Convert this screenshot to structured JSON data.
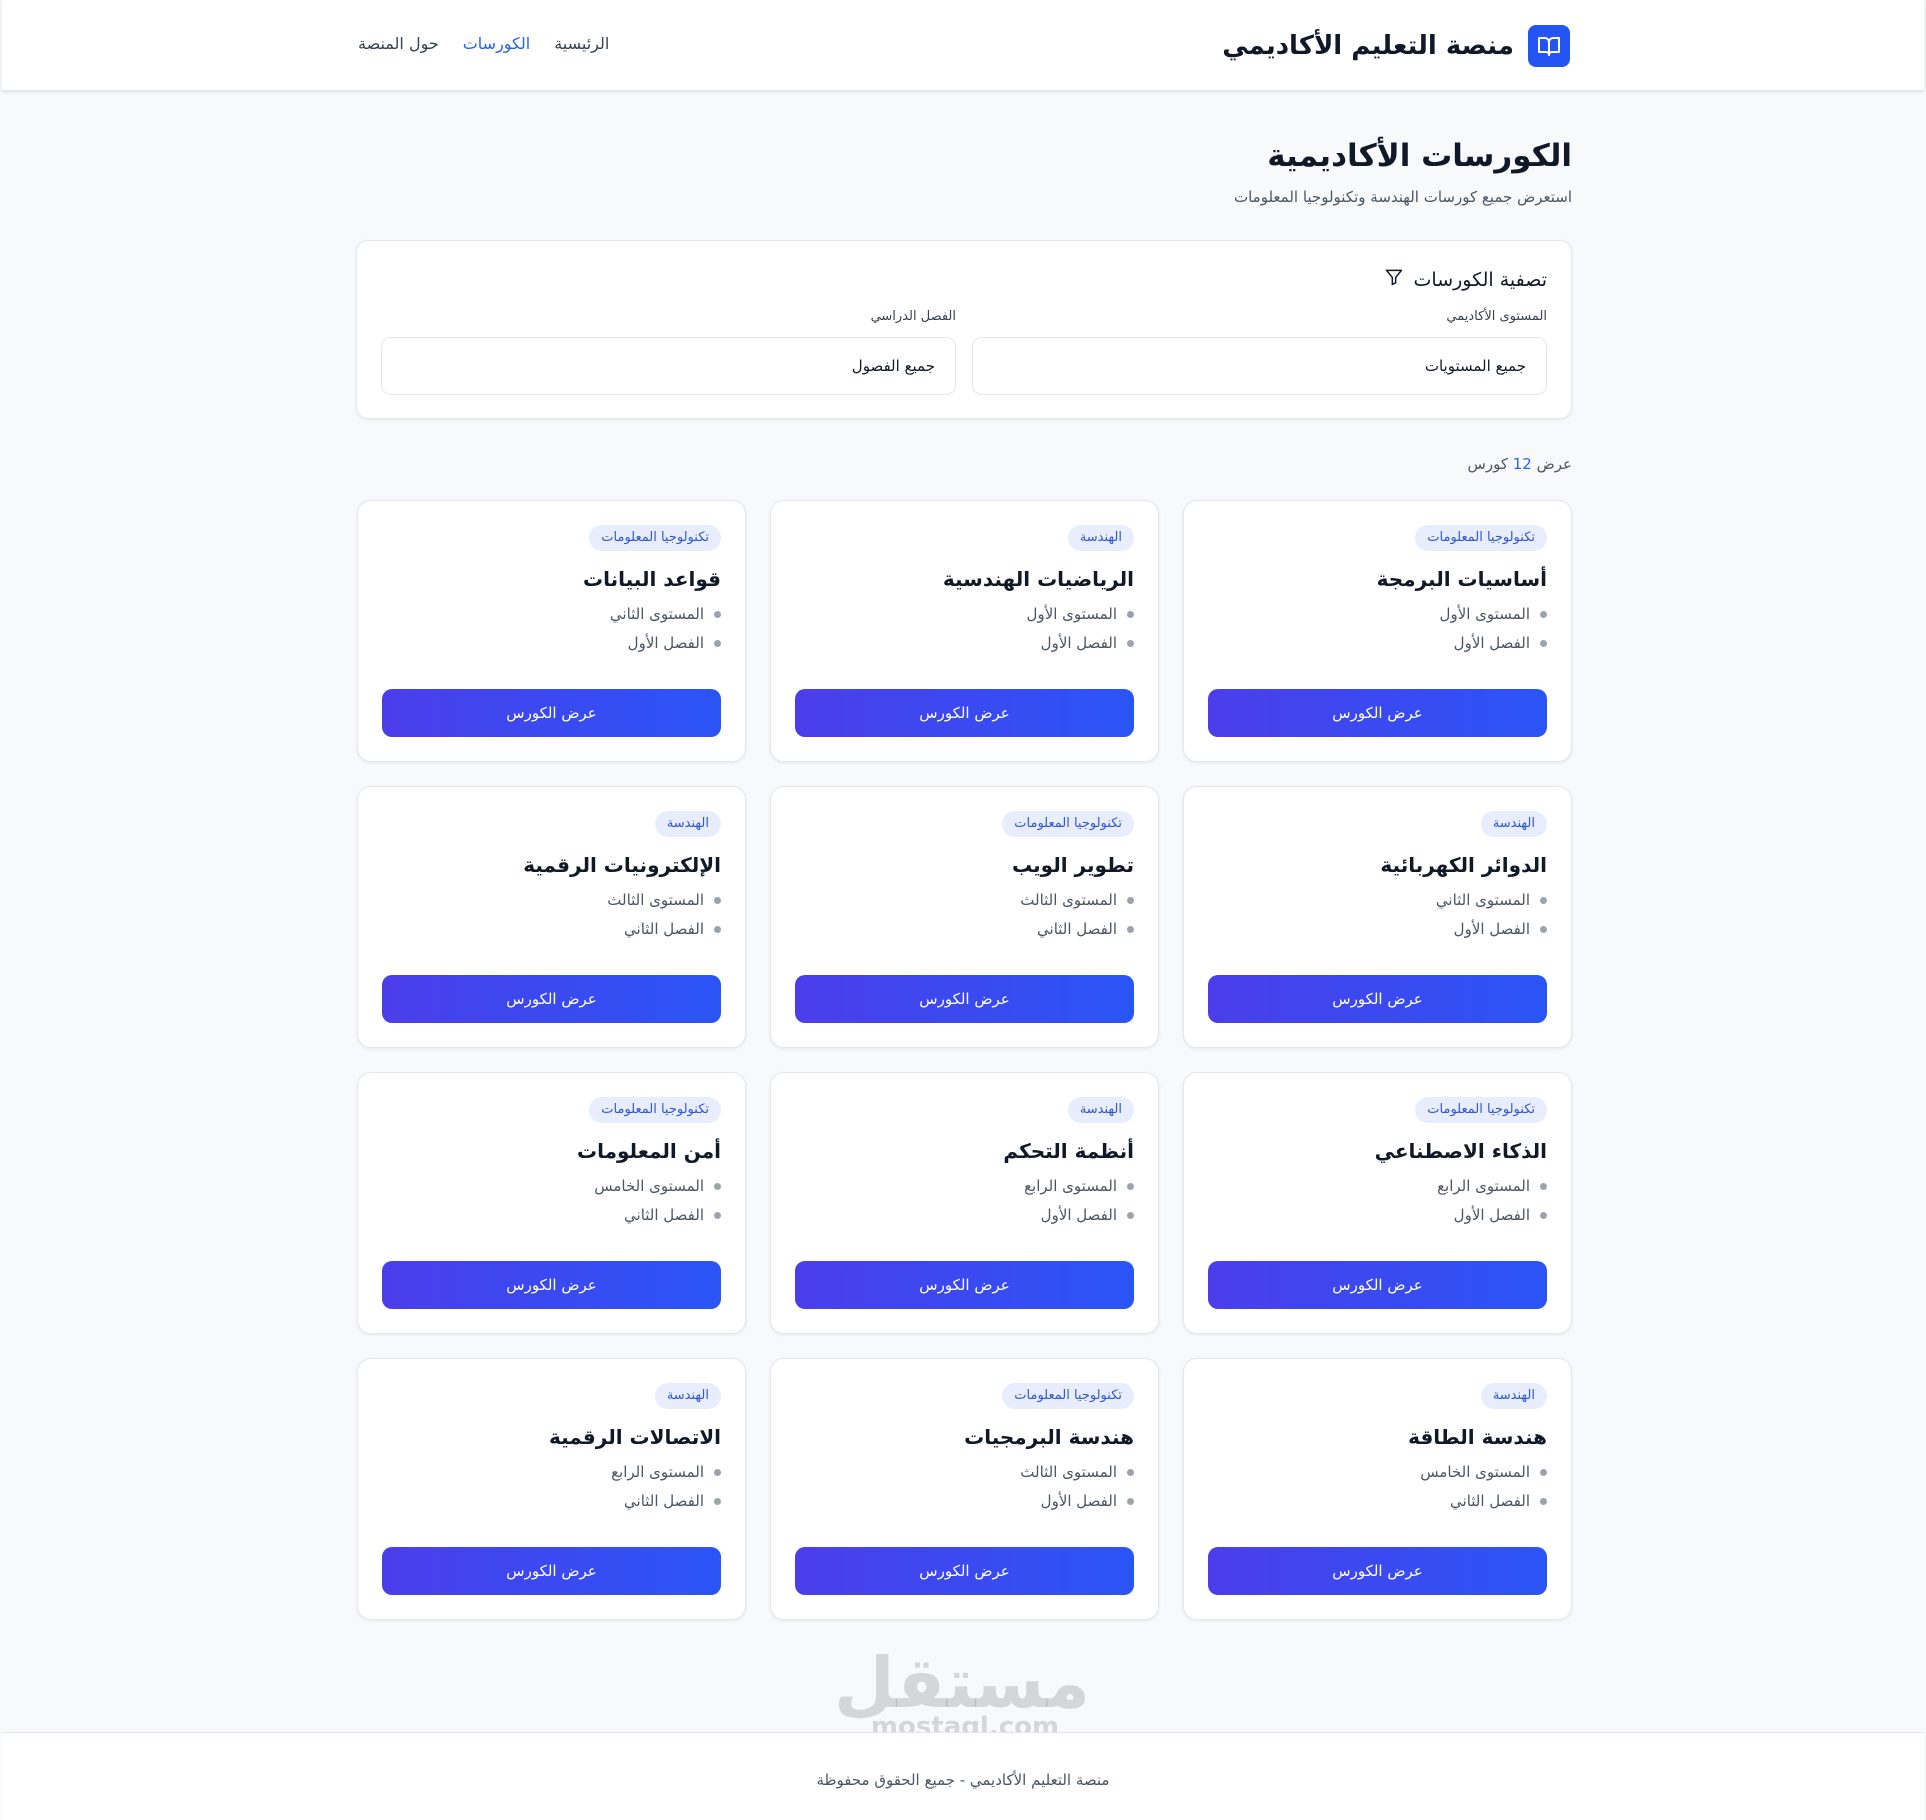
{
  "header": {
    "brand_title": "منصة التعليم الأكاديمي",
    "nav": [
      {
        "label": "الرئيسية",
        "active": false
      },
      {
        "label": "الكورسات",
        "active": true
      },
      {
        "label": "حول المنصة",
        "active": false
      }
    ]
  },
  "page": {
    "title": "الكورسات الأكاديمية",
    "subtitle": "استعرض جميع كورسات الهندسة وتكنولوجيا المعلومات"
  },
  "filter": {
    "heading": "تصفية الكورسات",
    "level_label": "المستوى الأكاديمي",
    "level_value": "جميع المستويات",
    "semester_label": "الفصل الدراسي",
    "semester_value": "جميع الفصول"
  },
  "count": {
    "prefix": "عرض",
    "number": "12",
    "suffix": "كورس"
  },
  "card_button_label": "عرض الكورس",
  "courses": [
    {
      "badge": "تكنولوجيا المعلومات",
      "title": "أساسيات البرمجة",
      "level": "المستوى الأول",
      "semester": "الفصل الأول"
    },
    {
      "badge": "الهندسة",
      "title": "الرياضيات الهندسية",
      "level": "المستوى الأول",
      "semester": "الفصل الأول"
    },
    {
      "badge": "تكنولوجيا المعلومات",
      "title": "قواعد البيانات",
      "level": "المستوى الثاني",
      "semester": "الفصل الأول"
    },
    {
      "badge": "الهندسة",
      "title": "الدوائر الكهربائية",
      "level": "المستوى الثاني",
      "semester": "الفصل الأول"
    },
    {
      "badge": "تكنولوجيا المعلومات",
      "title": "تطوير الويب",
      "level": "المستوى الثالث",
      "semester": "الفصل الثاني"
    },
    {
      "badge": "الهندسة",
      "title": "الإلكترونيات الرقمية",
      "level": "المستوى الثالث",
      "semester": "الفصل الثاني"
    },
    {
      "badge": "تكنولوجيا المعلومات",
      "title": "الذكاء الاصطناعي",
      "level": "المستوى الرابع",
      "semester": "الفصل الأول"
    },
    {
      "badge": "الهندسة",
      "title": "أنظمة التحكم",
      "level": "المستوى الرابع",
      "semester": "الفصل الأول"
    },
    {
      "badge": "تكنولوجيا المعلومات",
      "title": "أمن المعلومات",
      "level": "المستوى الخامس",
      "semester": "الفصل الثاني"
    },
    {
      "badge": "الهندسة",
      "title": "هندسة الطاقة",
      "level": "المستوى الخامس",
      "semester": "الفصل الثاني"
    },
    {
      "badge": "تكنولوجيا المعلومات",
      "title": "هندسة البرمجيات",
      "level": "المستوى الثالث",
      "semester": "الفصل الأول"
    },
    {
      "badge": "الهندسة",
      "title": "الاتصالات الرقمية",
      "level": "المستوى الرابع",
      "semester": "الفصل الثاني"
    }
  ],
  "watermark": {
    "arabic": "مستقل",
    "latin": "mostaql.com"
  },
  "footer": {
    "text": "منصة التعليم الأكاديمي - جميع الحقوق محفوظة"
  },
  "colors": {
    "accent": "#2563eb",
    "button_start": "#2a55f6",
    "button_end": "#4b3eea",
    "badge_bg": "#e8edfd"
  },
  "icons": {
    "brand": "open-book-icon",
    "filter": "funnel-icon"
  }
}
